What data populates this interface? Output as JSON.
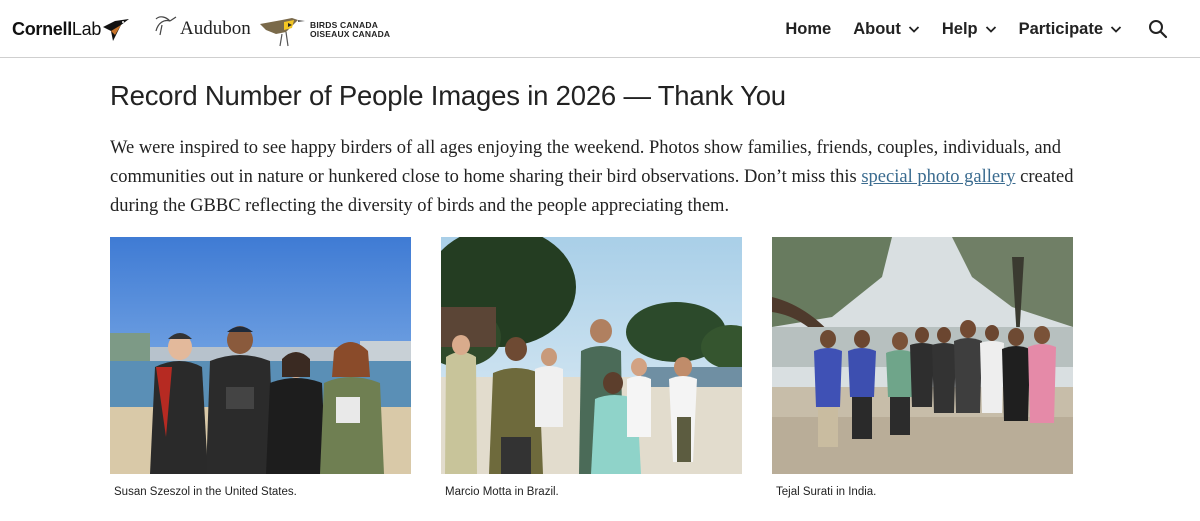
{
  "header": {
    "logos": {
      "cornell_bold": "Cornell",
      "cornell_light": "Lab",
      "audubon": "Audubon",
      "birds_canada_line1": "BIRDS CANADA",
      "birds_canada_line2": "OISEAUX CANADA"
    },
    "nav": {
      "home": "Home",
      "about": "About",
      "help": "Help",
      "participate": "Participate"
    }
  },
  "article": {
    "title": "Record Number of People Images in 2026 — Thank You",
    "intro_part1": "We were inspired to see happy birders of all ages enjoying the weekend. Photos show families, friends, couples, individuals, and communities out in nature or hunkered close to home sharing their bird observations. Don’t miss this ",
    "intro_link": "special photo gallery",
    "intro_part2": " created during the GBBC reflecting the diversity of birds and the people appreciating them."
  },
  "photos": [
    {
      "caption": "Susan Szeszol in the United States."
    },
    {
      "caption": "Marcio Motta in Brazil."
    },
    {
      "caption": "Tejal Surati in India."
    }
  ],
  "colors": {
    "link": "#3a6b8f",
    "header_border": "#cfcfcf"
  },
  "icons": {
    "chevron": "chevron-down-icon",
    "search": "search-icon"
  }
}
